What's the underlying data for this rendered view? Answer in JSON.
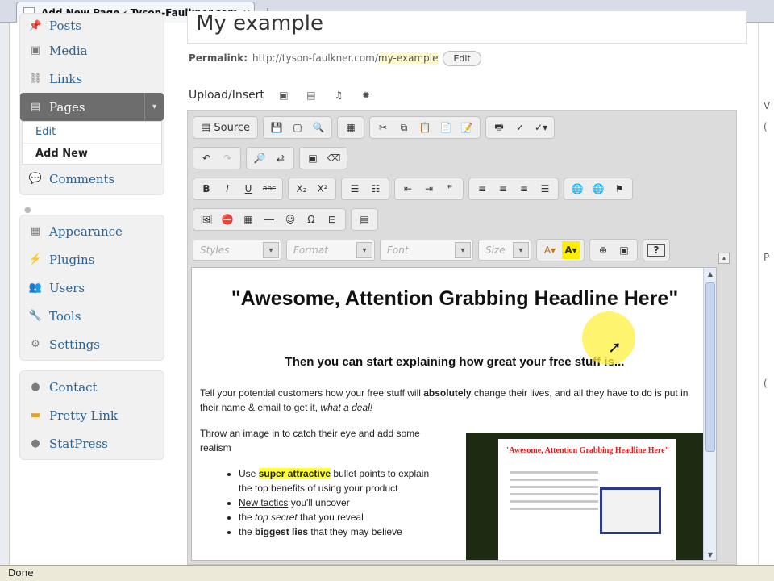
{
  "browser": {
    "tab_title": "Add New Page ‹ Tyson-Faulkner.com...",
    "tab_close": "×",
    "new_tab": "+"
  },
  "sidebar": {
    "group1": [
      {
        "label": "Posts",
        "icon": "pin-icon"
      },
      {
        "label": "Media",
        "icon": "media-icon"
      },
      {
        "label": "Links",
        "icon": "link-icon"
      },
      {
        "label": "Pages",
        "icon": "pages-icon",
        "active": true
      }
    ],
    "pages_submenu": {
      "edit": "Edit",
      "add_new": "Add New"
    },
    "comments": "Comments",
    "group2": [
      {
        "label": "Appearance",
        "icon": "appearance-icon"
      },
      {
        "label": "Plugins",
        "icon": "plugin-icon"
      },
      {
        "label": "Users",
        "icon": "users-icon"
      },
      {
        "label": "Tools",
        "icon": "tools-icon"
      },
      {
        "label": "Settings",
        "icon": "settings-icon"
      }
    ],
    "group3": [
      {
        "label": "Contact",
        "icon": "contact-icon"
      },
      {
        "label": "Pretty Link",
        "icon": "prettylink-icon"
      },
      {
        "label": "StatPress",
        "icon": "statpress-icon"
      }
    ]
  },
  "main": {
    "title": "My example",
    "permalink_label": "Permalink:",
    "permalink_base": "http://tyson-faulkner.com/",
    "permalink_slug": "my-example",
    "permalink_edit": "Edit",
    "upload_insert": "Upload/Insert"
  },
  "toolbar": {
    "source_label": "Source",
    "styles": "Styles",
    "format": "Format",
    "font": "Font",
    "size": "Size",
    "bold": "B",
    "italic": "I",
    "underline": "U",
    "strike": "abc",
    "subscript": "X₂",
    "superscript": "X²",
    "omega": "Ω",
    "help": "?"
  },
  "content": {
    "headline": "\"Awesome, Attention Grabbing Headline Here\"",
    "subheadline": "Then you can start explaining how great your free stuff is...",
    "para1_a": "Tell your potential customers how your free stuff will ",
    "para1_b": "absolutely",
    "para1_c": " change their lives, and all they have to do is put in their name & email to get it, ",
    "para1_d": "what a deal!",
    "para2": "Throw an image in to catch their eye and add some realism",
    "bullet1_a": "Use ",
    "bullet1_b": "super attractive",
    "bullet1_c": " bullet points to explain the top benefits of using your product",
    "bullet2_a": "New tactics",
    "bullet2_b": " you'll uncover",
    "bullet3_a": "the ",
    "bullet3_b": "top secret",
    "bullet3_c": " that you reveal",
    "bullet4_a": "the ",
    "bullet4_b": "biggest lies",
    "bullet4_c": " that they may believe",
    "thumb_title": "\"Awesome, Attention Grabbing Headline Here\""
  },
  "rightpanel": [
    "V",
    "(",
    "P",
    "("
  ],
  "status": "Done"
}
